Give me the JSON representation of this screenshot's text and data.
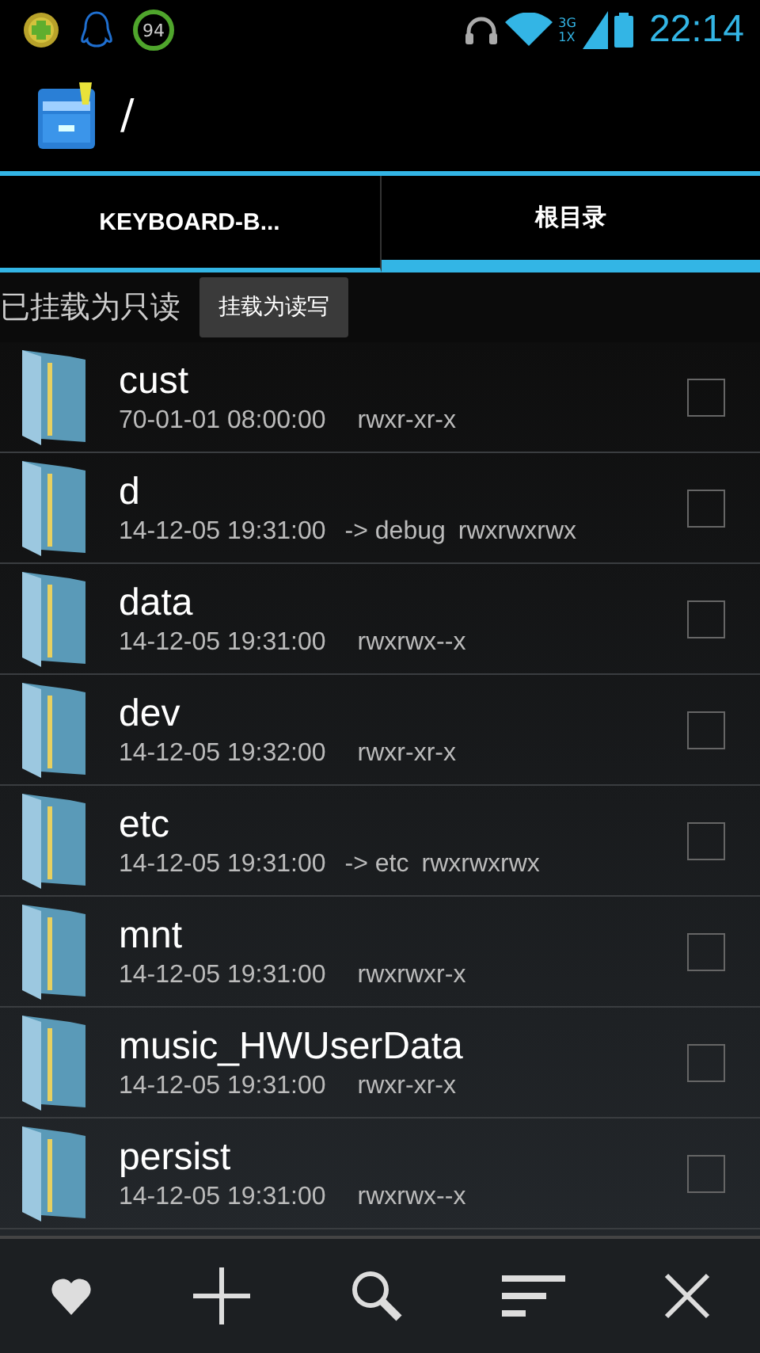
{
  "status_bar": {
    "badge": "94",
    "time": "22:14",
    "network": "3G",
    "network_alt": "1X"
  },
  "app_bar": {
    "path": "/"
  },
  "tabs": [
    {
      "label": "KEYBOARD-B...",
      "selected": false
    },
    {
      "label": "根目录",
      "selected": true
    }
  ],
  "mount": {
    "status": "已挂载为只读",
    "button": "挂载为读写"
  },
  "files": [
    {
      "name": "cust",
      "date": "70-01-01 08:00:00",
      "perms": "rwxr-xr-x",
      "checked": false
    },
    {
      "name": "d",
      "date": "14-12-05 19:31:00",
      "link": "-> debug",
      "perms": "rwxrwxrwx",
      "checked": false
    },
    {
      "name": "data",
      "date": "14-12-05 19:31:00",
      "perms": "rwxrwx--x",
      "checked": false
    },
    {
      "name": "dev",
      "date": "14-12-05 19:32:00",
      "perms": "rwxr-xr-x",
      "checked": false
    },
    {
      "name": "etc",
      "date": "14-12-05 19:31:00",
      "link": "-> etc",
      "perms": "rwxrwxrwx",
      "checked": false
    },
    {
      "name": "mnt",
      "date": "14-12-05 19:31:00",
      "perms": "rwxrwxr-x",
      "checked": false
    },
    {
      "name": "music_HWUserData",
      "date": "14-12-05 19:31:00",
      "perms": "rwxr-xr-x",
      "checked": false
    },
    {
      "name": "persist",
      "date": "14-12-05 19:31:00",
      "perms": "rwxrwx--x",
      "checked": false
    }
  ],
  "toolbar": [
    {
      "kind": "favorite"
    },
    {
      "kind": "new"
    },
    {
      "kind": "search"
    },
    {
      "kind": "sort"
    },
    {
      "kind": "close"
    }
  ]
}
